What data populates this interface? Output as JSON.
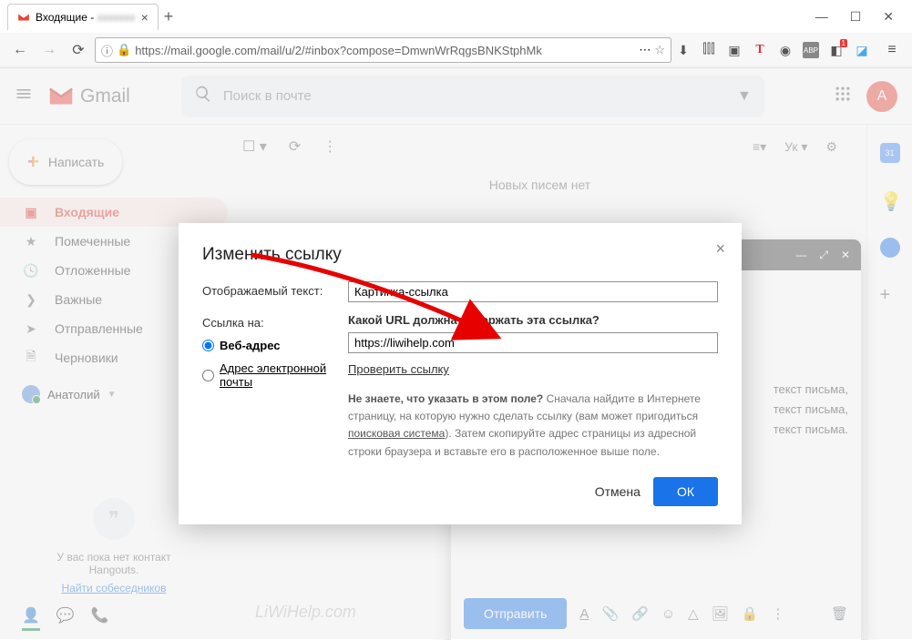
{
  "browser": {
    "tab_title": "Входящие -",
    "url": "https://mail.google.com/mail/u/2/#inbox?compose=DmwnWrRqgsBNKStphMk"
  },
  "header": {
    "brand": "Gmail",
    "search_placeholder": "Поиск в почте",
    "avatar_letter": "A"
  },
  "compose_button": "Написать",
  "nav": {
    "inbox": "Входящие",
    "starred": "Помеченные",
    "snoozed": "Отложенные",
    "important": "Важные",
    "sent": "Отправленные",
    "drafts": "Черновики"
  },
  "user_name": "Анатолий",
  "toolbar": {
    "lang": "Ук"
  },
  "empty": "Новых писем нет",
  "compose": {
    "body_line": "текст письма,",
    "body_line_end": "текст письма.",
    "send": "Отправить"
  },
  "hangouts": {
    "text": "У вас пока нет контакт\nHangouts.",
    "link": "Найти собеседников"
  },
  "watermark": "LiWiHelp.com",
  "modal": {
    "title": "Изменить ссылку",
    "display_label": "Отображаемый текст:",
    "display_value": "Картинка-ссылка",
    "link_to_label": "Ссылка на:",
    "radio_web": "Веб-адрес",
    "radio_email": "Адрес электронной почты",
    "url_prompt": "Какой URL должна содержать эта ссылка?",
    "url_value": "https://liwihelp.com",
    "check_link": "Проверить ссылку",
    "hint_prefix": "Не знаете, что указать в этом поле?",
    "hint_body": " Сначала найдите в Интернете страницу, на которую нужно сделать ссылку (вам может пригодиться ",
    "hint_link": "поисковая система",
    "hint_tail": "). Затем скопируйте адрес страницы из адресной строки браузера и вставьте его в расположенное выше поле.",
    "cancel": "Отмена",
    "ok": "ОК"
  }
}
